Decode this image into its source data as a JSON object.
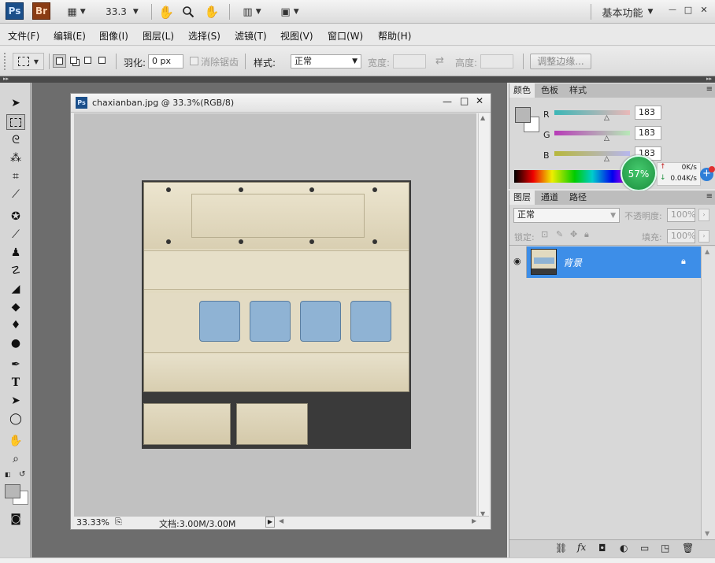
{
  "appbar": {
    "ps_logo": "Ps",
    "br_logo": "Br",
    "zoom_value": "33.3",
    "workspace_label": "基本功能",
    "minimize": "—",
    "maximize": "□",
    "close": "✕"
  },
  "menu": [
    "文件(F)",
    "编辑(E)",
    "图像(I)",
    "图层(L)",
    "选择(S)",
    "滤镜(T)",
    "视图(V)",
    "窗口(W)",
    "帮助(H)"
  ],
  "options": {
    "feather_label": "羽化:",
    "feather_value": "0 px",
    "antialias_label": "消除锯齿",
    "style_label": "样式:",
    "style_value": "正常",
    "width_label": "宽度:",
    "height_label": "高度:",
    "refine_edge_button": "调整边缘..."
  },
  "document": {
    "title": "chaxianban.jpg @ 33.3%(RGB/8)",
    "zoom": "33.33%",
    "doc_info": "文档:3.00M/3.00M"
  },
  "color_panel": {
    "tabs": [
      "颜色",
      "色板",
      "样式"
    ],
    "r_label": "R",
    "r_value": "183",
    "g_label": "G",
    "g_value": "183",
    "b_label": "B",
    "b_value": "183"
  },
  "network_widget": {
    "percent": "57%",
    "upload": "0K/s",
    "download": "0.04K/s"
  },
  "layers_panel": {
    "tabs": [
      "图层",
      "通道",
      "路径"
    ],
    "blend_mode": "正常",
    "opacity_label": "不透明度:",
    "opacity_value": "100%",
    "lock_label": "锁定:",
    "fill_label": "填充:",
    "fill_value": "100%",
    "layer_name": "背景"
  }
}
